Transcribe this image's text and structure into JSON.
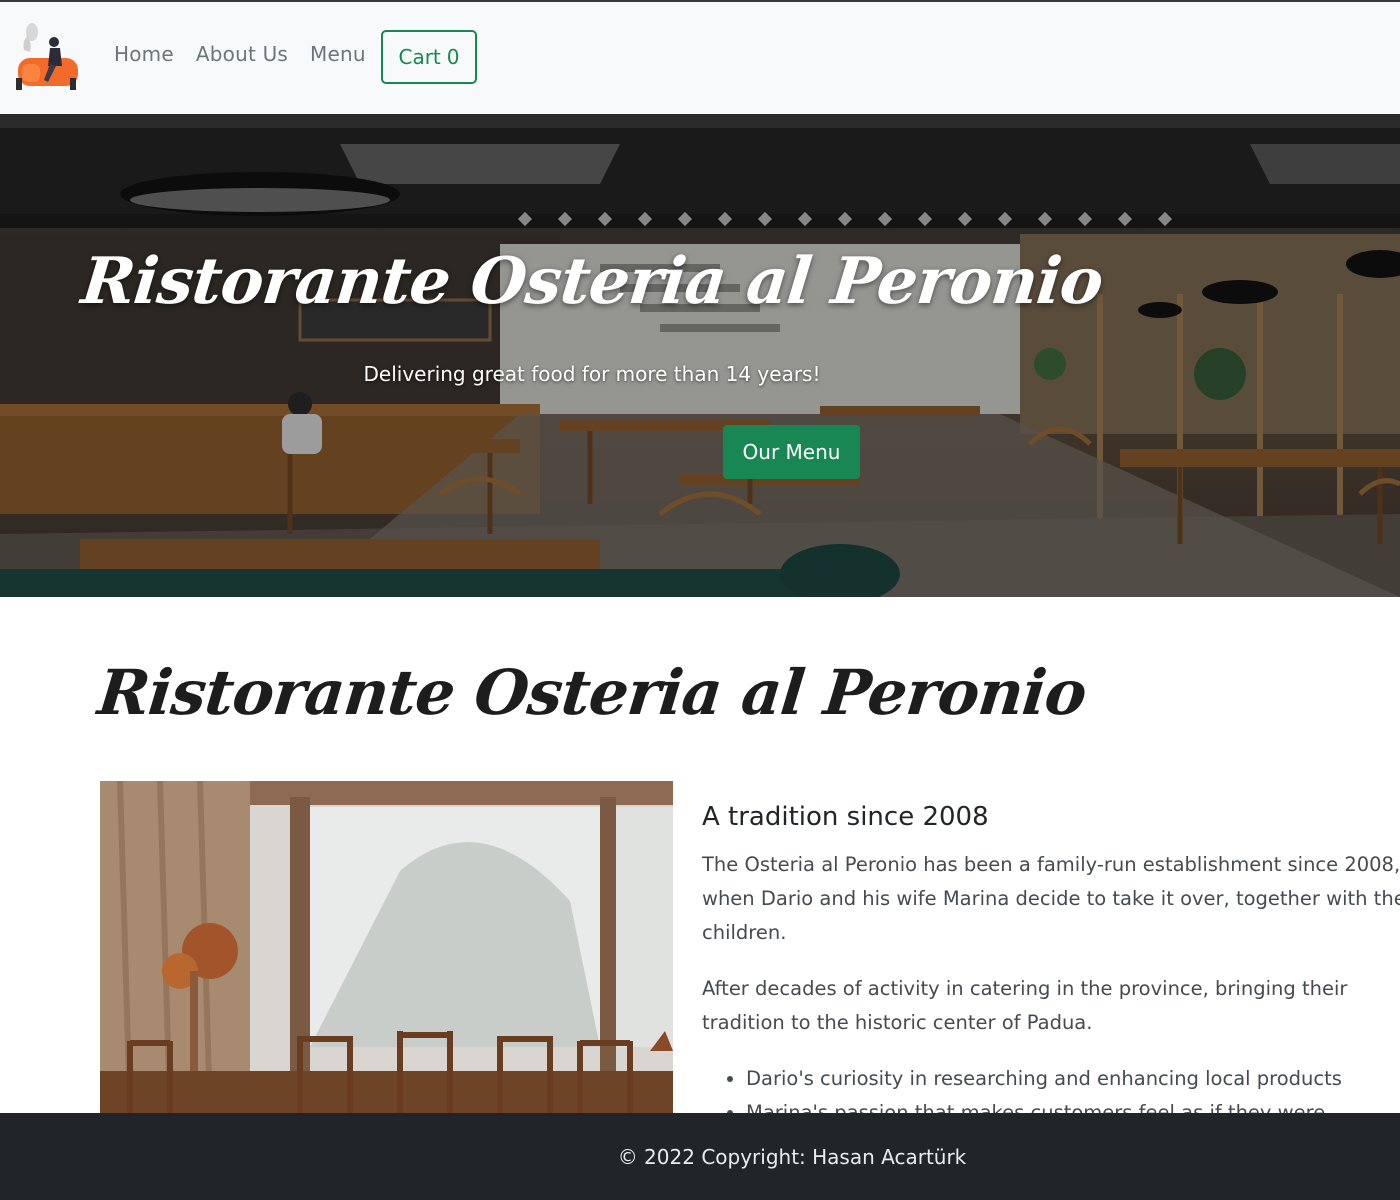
{
  "navbar": {
    "logo_icon": "restaurant-logo-icon",
    "links": [
      "Home",
      "About Us",
      "Menu"
    ],
    "cart": {
      "label": "Cart",
      "count": "0"
    }
  },
  "hero": {
    "title": "Ristorante Osteria al Peronio",
    "subtitle": "Delivering great food for more than 14 years!",
    "button": "Our Menu"
  },
  "main": {
    "title": "Ristorante Osteria al Peronio",
    "heading": "A tradition since 2008",
    "paragraphs": [
      "The Osteria al Peronio has been a family-run establishment since 2008, when Dario and his wife Marina decide to take it over, together with their children.",
      "After decades of activity in catering in the province, bringing their tradition to the historic center of Padua."
    ],
    "list": [
      "Dario's curiosity in researching and enhancing local products",
      "Marina's passion that makes customers feel as if they were immersed"
    ]
  },
  "footer": {
    "copyright": "© 2022 Copyright: Hasan Acartürk"
  },
  "colors": {
    "accent": "#198754",
    "footer_bg": "#212529",
    "navbar_bg": "#f8f9fa"
  }
}
